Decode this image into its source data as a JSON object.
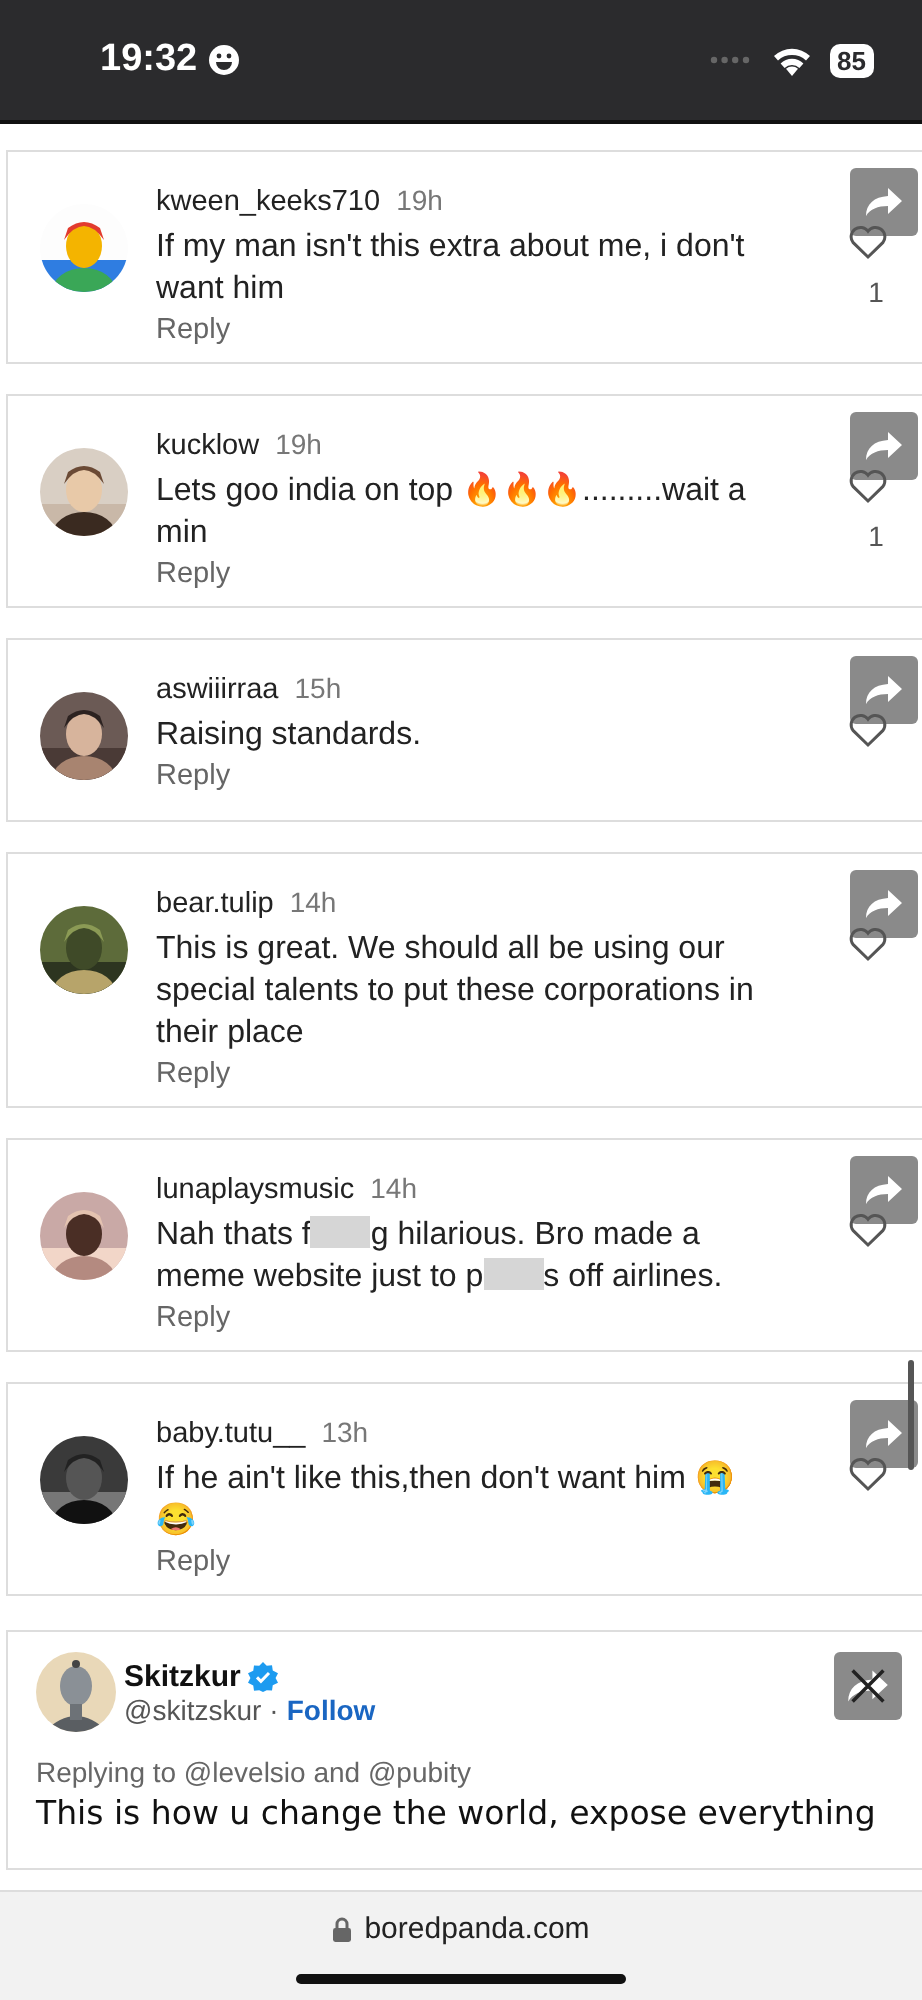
{
  "status_bar": {
    "time": "19:32",
    "battery": "85"
  },
  "comments": [
    {
      "user": "kween_keeks710",
      "age": "19h",
      "parts": [
        {
          "kind": "text",
          "text": "If my man isn't this extra about me, i don't want him"
        }
      ],
      "reply": "Reply",
      "likes": "1"
    },
    {
      "user": "kucklow",
      "age": "19h",
      "parts": [
        {
          "kind": "text",
          "text": "Lets goo india on top 🔥🔥🔥.........wait a min"
        }
      ],
      "reply": "Reply",
      "likes": "1"
    },
    {
      "user": "aswiiirraa",
      "age": "15h",
      "parts": [
        {
          "kind": "text",
          "text": "Raising standards."
        }
      ],
      "reply": "Reply"
    },
    {
      "user": "bear.tulip",
      "age": "14h",
      "parts": [
        {
          "kind": "text",
          "text": "This is great. We should all be using our special talents to put these corporations in their place"
        }
      ],
      "reply": "Reply"
    },
    {
      "user": "lunaplaysmusic",
      "age": "14h",
      "parts": [
        {
          "kind": "text",
          "text": "Nah thats f"
        },
        {
          "kind": "blur"
        },
        {
          "kind": "text",
          "text": "g hilarious. Bro made a meme website just to p"
        },
        {
          "kind": "blur"
        },
        {
          "kind": "text",
          "text": "s off airlines."
        }
      ],
      "reply": "Reply"
    },
    {
      "user": "baby.tutu__",
      "age": "13h",
      "parts": [
        {
          "kind": "text",
          "text": "If he ain't like this,then don't want him 😭 😂"
        }
      ],
      "reply": "Reply"
    }
  ],
  "tweet": {
    "name": "Skitzkur",
    "verified": true,
    "handle": "@skitzskur",
    "separator": "·",
    "follow": "Follow",
    "replying": "Replying to @levelsio and @pubity",
    "text": "This is how u change the world, expose everything"
  },
  "address_bar": {
    "url": "boredpanda.com"
  }
}
